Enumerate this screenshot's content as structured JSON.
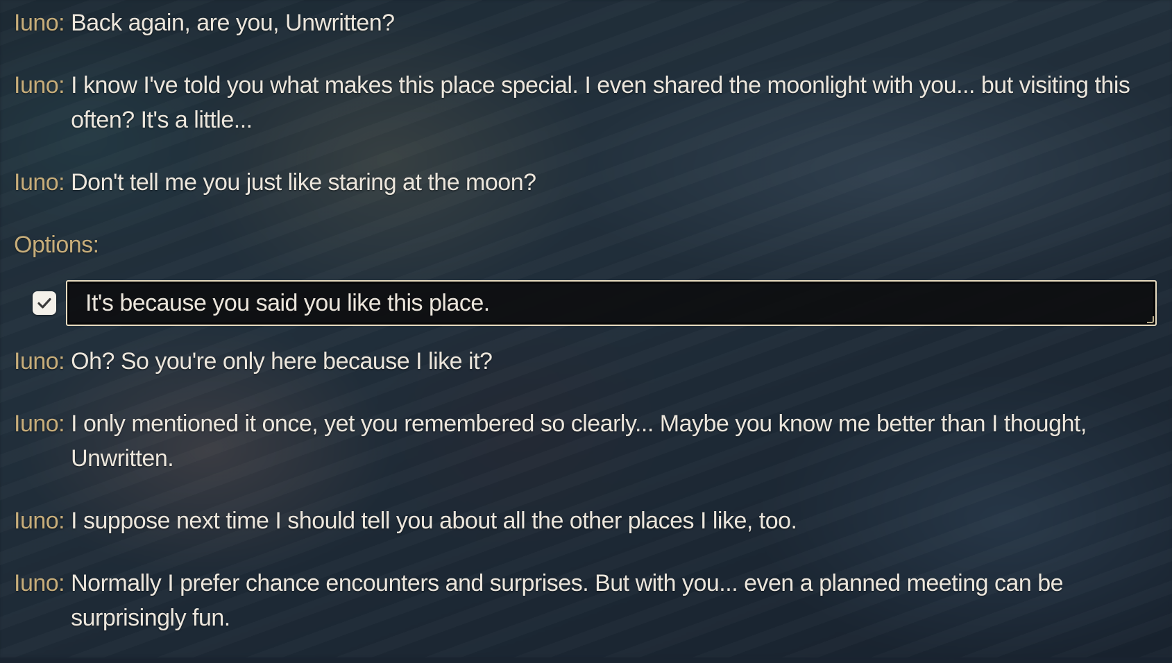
{
  "dialogue_before": [
    {
      "speaker": "Iuno:",
      "text": "Back again, are you, Unwritten?"
    },
    {
      "speaker": "Iuno:",
      "text": "I know I've told you what makes this place special. I even shared the moonlight with you... but visiting this often? It's a little..."
    },
    {
      "speaker": "Iuno:",
      "text": "Don't tell me you just like staring at the moon?"
    }
  ],
  "options": {
    "label": "Options:",
    "items": [
      {
        "text": "It's because you said you like this place.",
        "checked": true,
        "icon": "checkmark-icon"
      }
    ]
  },
  "dialogue_after": [
    {
      "speaker": "Iuno:",
      "text": "Oh? So you're only here because I like it?"
    },
    {
      "speaker": "Iuno:",
      "text": "I only mentioned it once, yet you remembered so clearly... Maybe you know me better than I thought, Unwritten."
    },
    {
      "speaker": "Iuno:",
      "text": "I suppose next time I should tell you about all the other places I like, too."
    },
    {
      "speaker": "Iuno:",
      "text": "Normally I prefer chance encounters and surprises. But with you... even a planned meeting can be surprisingly fun."
    }
  ],
  "colors": {
    "speaker": "#c7ad7a",
    "text": "#ece6dc",
    "option_border": "#e8dcc0"
  }
}
